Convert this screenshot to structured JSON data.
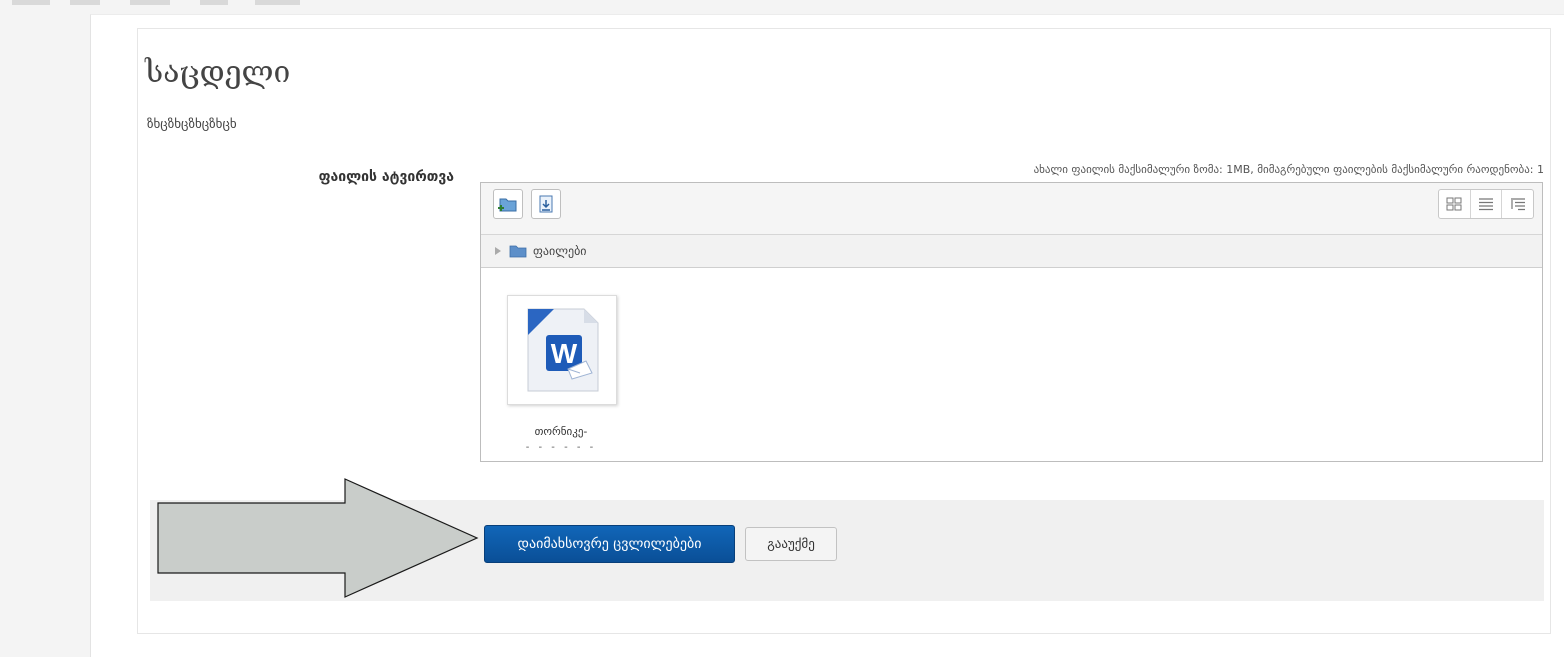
{
  "page": {
    "title": "საცდელი",
    "description": "ზხცზხცზხცზხცხ"
  },
  "form": {
    "field_label": "ფაილის ატვირთვა",
    "limits_text": "ახალი ფაილის მაქსიმალური ზომა: 1MB, მიმაგრებული ფაილების მაქსიმალური რაოდენობა: 1"
  },
  "file_manager": {
    "toolbar_icons": [
      "add-folder-icon",
      "download-icon"
    ],
    "view_modes": [
      "grid-view-icon",
      "list-view-icon",
      "tree-view-icon"
    ],
    "path_label": "ფაილები",
    "files": [
      {
        "name": "თორნიკე-",
        "name_overflow": "- - - - - -",
        "icon": "word-document-icon"
      }
    ]
  },
  "actions": {
    "save_label": "დაიმახსოვრე ცვლილებები",
    "cancel_label": "გააუქმე"
  },
  "colors": {
    "primary": "#0a559f",
    "arrow_fill": "#c9cdca",
    "arrow_stroke": "#1a1a1a"
  }
}
